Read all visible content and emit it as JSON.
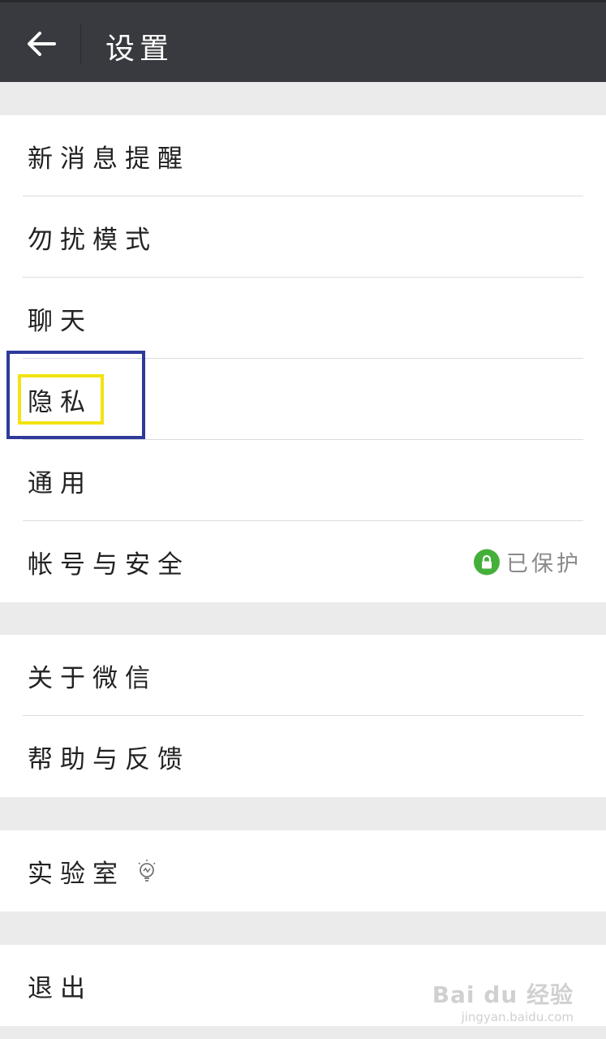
{
  "header": {
    "title": "设置"
  },
  "groups": [
    {
      "items": [
        {
          "label": "新消息提醒"
        },
        {
          "label": "勿扰模式"
        },
        {
          "label": "聊天"
        },
        {
          "label": "隐私"
        },
        {
          "label": "通用"
        },
        {
          "label": "帐号与安全",
          "status": "已保护"
        }
      ]
    },
    {
      "items": [
        {
          "label": "关于微信"
        },
        {
          "label": "帮助与反馈"
        }
      ]
    },
    {
      "items": [
        {
          "label": "实验室"
        }
      ]
    },
    {
      "items": [
        {
          "label": "退出"
        }
      ]
    }
  ],
  "watermark": {
    "main": "Bai du 经验",
    "sub": "jingyan.baidu.com"
  },
  "colors": {
    "topbar": "#393a3f",
    "background": "#ebebeb",
    "protect_green": "#44b03a",
    "highlight_blue": "#2e3a9a",
    "highlight_yellow": "#f1e40f"
  },
  "icons": {
    "back": "arrow-left-icon",
    "lock": "lock-icon",
    "lab": "lightbulb-icon"
  }
}
